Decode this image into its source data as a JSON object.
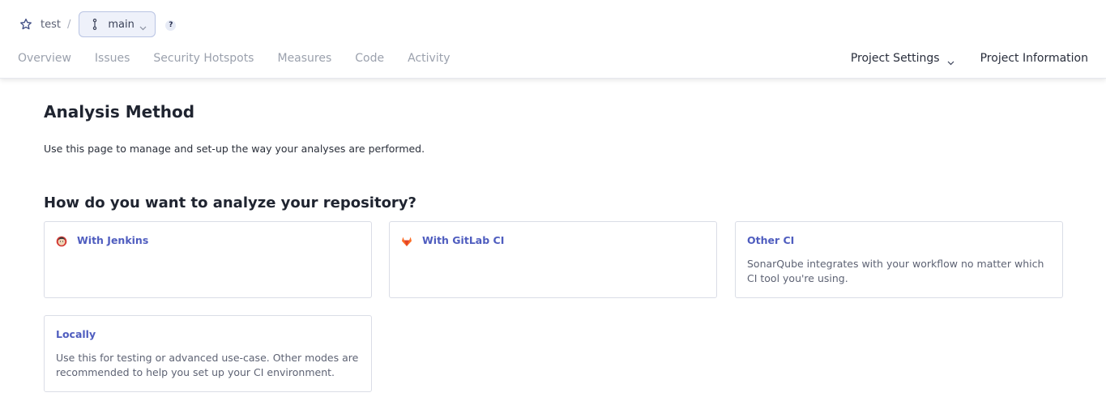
{
  "header": {
    "project_name": "test",
    "separator": "/",
    "branch": "main",
    "help_label": "?"
  },
  "nav": {
    "items": [
      "Overview",
      "Issues",
      "Security Hotspots",
      "Measures",
      "Code",
      "Activity"
    ],
    "project_settings": "Project Settings",
    "project_information": "Project Information"
  },
  "main": {
    "title": "Analysis Method",
    "description": "Use this page to manage and set-up the way your analyses are performed.",
    "section_title": "How do you want to analyze your repository?",
    "cards": [
      {
        "title": "With Jenkins",
        "description": "",
        "icon": "jenkins-icon"
      },
      {
        "title": "With GitLab CI",
        "description": "",
        "icon": "gitlab-icon"
      },
      {
        "title": "Other CI",
        "description": "SonarQube integrates with your workflow no matter which CI tool you're using.",
        "icon": ""
      },
      {
        "title": "Locally",
        "description": "Use this for testing or advanced use-case. Other modes are recommended to help you set up your CI environment.",
        "icon": ""
      }
    ]
  },
  "colors": {
    "link": "#4f5dbf",
    "card_border": "#dadde6",
    "branch_bg": "#eef1fa"
  }
}
